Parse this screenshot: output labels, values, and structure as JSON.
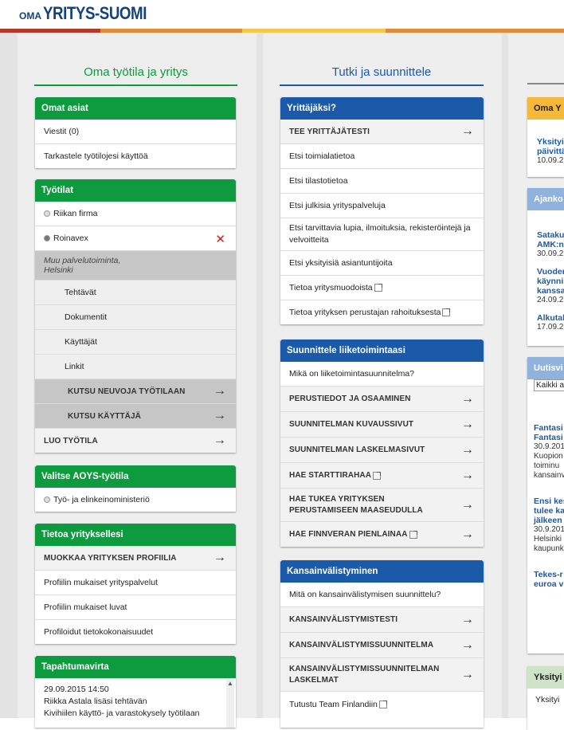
{
  "logo": {
    "prefix": "OMA",
    "brand": "YRITYS-SUOMI"
  },
  "colors": {
    "green": "#0e9a3e",
    "blue": "#1a5aa8",
    "brand": "#13437a"
  },
  "col1": {
    "title": "Oma työtila ja yritys",
    "omat": {
      "header": "Omat asiat",
      "items": [
        "Viestit (0)",
        "Tarkastele työtilojesi käyttöä"
      ]
    },
    "tyotilat": {
      "header": "Työtilat",
      "ws1": "Riikan firma",
      "ws2": "Roinavex",
      "ws2_desc1": "Muu palvelutoiminta,",
      "ws2_desc2": "Helsinki",
      "sub": [
        "Tehtävät",
        "Dokumentit",
        "Käyttäjät",
        "Linkit"
      ],
      "invite_advisor": "KUTSU NEUVOJA TYÖTILAAN",
      "invite_user": "KUTSU KÄYTTÄJÄ",
      "create": "LUO TYÖTILA"
    },
    "aoys": {
      "header": "Valitse AOYS-työtila",
      "item": "Työ- ja elinkeinoministeriö"
    },
    "tietoa": {
      "header": "Tietoa yrityksellesi",
      "edit": "MUOKKAA YRITYKSEN PROFIILIA",
      "items": [
        "Profiilin mukaiset yrityspalvelut",
        "Profiilin mukaiset luvat",
        "Profiloidut tietokokonaisuudet"
      ]
    },
    "tapahtuma": {
      "header": "Tapahtumavirta",
      "time": "29.09.2015 14:50",
      "line1": "Riikka Astala lisäsi tehtävän",
      "line2": "Kivihiilen käyttö- ja varastokysely työtilaan"
    }
  },
  "col2": {
    "title": "Tutki ja suunnittele",
    "yrittajaksi": {
      "header": "Yrittäjäksi?",
      "test": "TEE YRITTÄJÄTESTI",
      "items": [
        "Etsi toimialatietoa",
        "Etsi tilastotietoa",
        "Etsi julkisia yrityspalveluja",
        "Etsi tarvittavia lupia, ilmoituksia, rekisteröintejä ja velvoitteita",
        "Etsi yksityisiä asiantuntijoita",
        "Tietoa yritysmuodoista",
        "Tietoa yrityksen perustajan rahoituksesta"
      ]
    },
    "suunnittele": {
      "header": "Suunnittele liiketoimintaasi",
      "intro": "Mikä on liiketoimintasuunnitelma?",
      "items": [
        "PERUSTIEDOT JA OSAAMINEN",
        "SUUNNITELMAN KUVAUSSIVUT",
        "SUUNNITELMAN LASKELMASIVUT",
        "HAE STARTTIRAHAA",
        "HAE TUKEA YRITYKSEN PERUSTAMISEEN MAASEUDULLA",
        "HAE FINNVERAN PIENLAINAA"
      ]
    },
    "kv": {
      "header": "Kansainvälistyminen",
      "intro": "Mitä on kansainvälistymisen suunnittelu?",
      "items": [
        "KANSAINVÄLISTYMISTESTI",
        "KANSAINVÄLISTYMISSUUNNITELMA",
        "KANSAINVÄLISTYMISSUUNNITELMAN LASKELMAT"
      ],
      "team": "Tutustu Team Finlandiin"
    }
  },
  "col3": {
    "box1": {
      "header": "Oma Y",
      "link1": "Yksityis",
      "link2": "päivittä",
      "date": "10.09.2"
    },
    "box2": {
      "header": "Ajanko",
      "items": [
        [
          "Satakun",
          "AMK:n",
          "30.09.2"
        ],
        [
          "Vuoder",
          "käynnis",
          "kanssa",
          "24.09.2"
        ],
        [
          "Alkutal",
          "17.09.2"
        ]
      ]
    },
    "box3": {
      "header": "Uutisvi",
      "select": "Kaikki a",
      "news": [
        [
          "Fantasi",
          "Fantasi",
          "30.9.201",
          "Kuopion",
          "toiminu",
          "kansainv"
        ],
        [
          "Ensi kes",
          "tulee ka",
          "jälkeen",
          "30.9.201",
          "Helsinki",
          "kaupunk"
        ],
        [
          "Tekes-r",
          "euroa v"
        ]
      ]
    },
    "box4": {
      "header": "Yksityi",
      "item": "Yksityi"
    }
  }
}
